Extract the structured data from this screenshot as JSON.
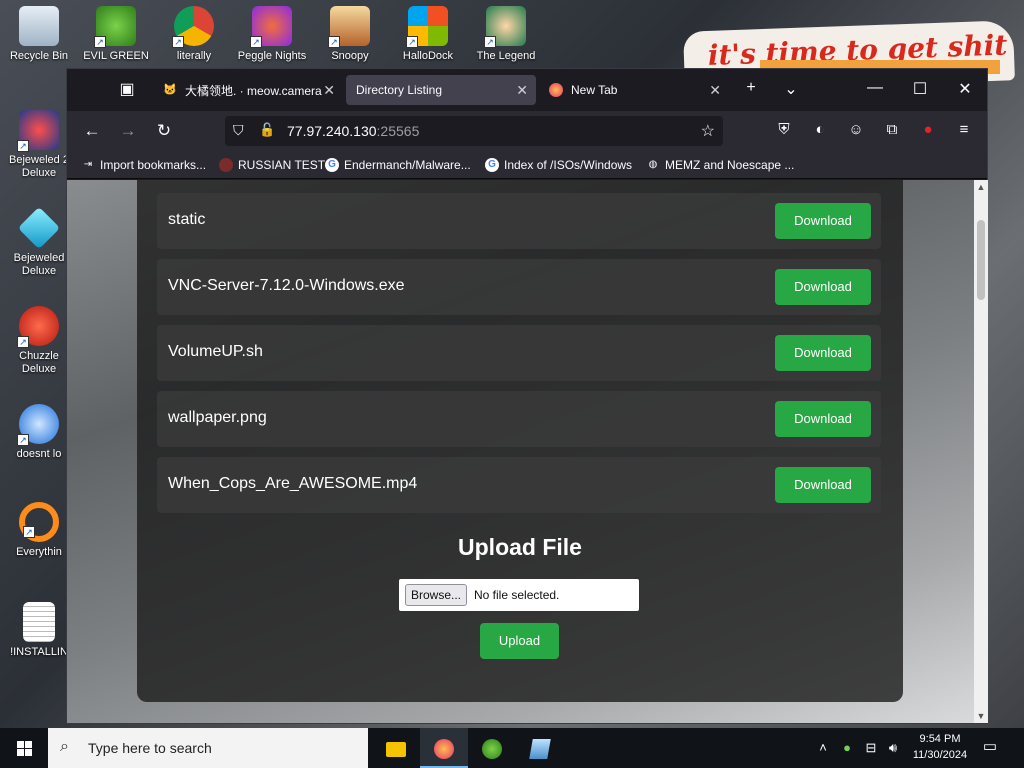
{
  "desktop": {
    "icons": [
      {
        "label": "Recycle Bin",
        "icon": "recycle-bin-icon"
      },
      {
        "label": "EVIL GREEN",
        "icon": "green-people-icon"
      },
      {
        "label": "literally",
        "icon": "chrome-icon"
      },
      {
        "label": "Peggle Nights",
        "icon": "peggle-icon"
      },
      {
        "label": "Snoopy",
        "icon": "snoopy-icon"
      },
      {
        "label": "HalloDock",
        "icon": "windows-logo-icon"
      },
      {
        "label": "The Legend",
        "icon": "legend-character-icon"
      },
      {
        "label": "Bejeweled 2 Deluxe",
        "icon": "bejeweled-2-icon"
      },
      {
        "label": "Bejeweled Deluxe",
        "icon": "diamond-icon"
      },
      {
        "label": "Chuzzle Deluxe",
        "icon": "chuzzle-icon"
      },
      {
        "label": "doesnt lo",
        "icon": "thunderbird-icon"
      },
      {
        "label": "Everythin",
        "icon": "everything-search-icon"
      },
      {
        "label": "!INSTALLIN",
        "icon": "text-file-icon"
      }
    ],
    "sticker_text": "it's time to get shit"
  },
  "browser": {
    "tabs": [
      {
        "label": "大橘领地. · meow.camera",
        "icon": "cat-icon",
        "active": false
      },
      {
        "label": "Directory Listing",
        "icon": "",
        "active": true
      },
      {
        "label": "New Tab",
        "icon": "firefox-icon",
        "active": false
      }
    ],
    "url_host": "77.97.240.130",
    "url_port": ":25565",
    "bookmarks": [
      {
        "label": "Import bookmarks...",
        "icon": "import-icon"
      },
      {
        "label": "RUSSIAN TEST",
        "icon": "squid-icon"
      },
      {
        "label": "Endermanch/Malware...",
        "icon": "google-icon"
      },
      {
        "label": "Index of /ISOs/Windows",
        "icon": "google-icon"
      },
      {
        "label": "MEMZ and Noescape ...",
        "icon": "globe-icon"
      }
    ]
  },
  "page": {
    "files": [
      {
        "name": "static",
        "action": "Download"
      },
      {
        "name": "VNC-Server-7.12.0-Windows.exe",
        "action": "Download"
      },
      {
        "name": "VolumeUP.sh",
        "action": "Download"
      },
      {
        "name": "wallpaper.png",
        "action": "Download"
      },
      {
        "name": "When_Cops_Are_AWESOME.mp4",
        "action": "Download"
      }
    ],
    "upload_title": "Upload File",
    "browse_label": "Browse...",
    "no_file_label": "No file selected.",
    "upload_label": "Upload"
  },
  "taskbar": {
    "search_placeholder": "Type here to search",
    "time": "9:54 PM",
    "date": "11/30/2024"
  },
  "colors": {
    "accent_green": "#28a745",
    "browser_dark": "#1c1b22",
    "toolbar": "#2b2a33"
  }
}
